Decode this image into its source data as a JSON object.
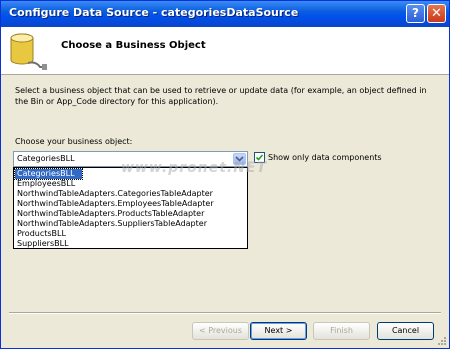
{
  "window": {
    "title": "Configure Data Source - categoriesDataSource",
    "help_glyph": "?",
    "close_glyph": "✕"
  },
  "header": {
    "title": "Choose a Business Object",
    "icon": "database-icon"
  },
  "description": "Select a business object that can be used to retrieve or update data (for example, an object defined in the Bin or App_Code directory for this application).",
  "choose": {
    "label": "Choose your business object:",
    "selected": "CategoriesBLL",
    "options": [
      "CategoriesBLL",
      "EmployeesBLL",
      "NorthwindTableAdapters.CategoriesTableAdapter",
      "NorthwindTableAdapters.EmployeesTableAdapter",
      "NorthwindTableAdapters.ProductsTableAdapter",
      "NorthwindTableAdapters.SuppliersTableAdapter",
      "ProductsBLL",
      "SuppliersBLL"
    ]
  },
  "show_only_data_components": {
    "label": "Show only data components",
    "checked": true
  },
  "watermark": "www.pronet.NET",
  "buttons": {
    "previous": "< Previous",
    "next": "Next >",
    "finish": "Finish",
    "cancel": "Cancel"
  },
  "colors": {
    "titlebar": "#0a5ddf",
    "selection": "#316ac5",
    "dialog_bg": "#ece9d8"
  }
}
